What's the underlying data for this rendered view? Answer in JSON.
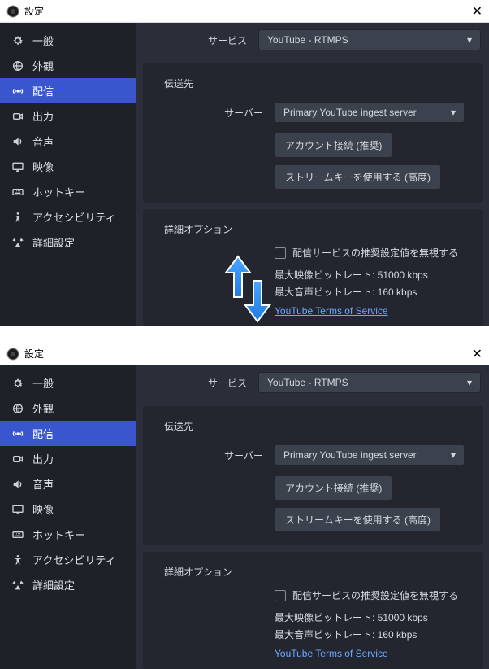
{
  "titlebar": {
    "title": "設定"
  },
  "sidebar": {
    "general": "一般",
    "appearance": "外観",
    "stream": "配信",
    "output": "出力",
    "audio": "音声",
    "video": "映像",
    "hotkeys": "ホットキー",
    "accessibility": "アクセシビリティ",
    "advanced": "詳細設定"
  },
  "main": {
    "service_label": "サービス",
    "service_value": "YouTube - RTMPS",
    "destination_head": "伝送先",
    "server_label": "サーバー",
    "server_value": "Primary YouTube ingest server",
    "connect_account_btn": "アカウント接続 (推奨)",
    "streamkey_btn": "ストリームキーを使用する (高度)",
    "advanced_head": "詳細オプション",
    "ignore_checkbox": "配信サービスの推奨設定値を無視する",
    "max_video": "最大映像ビットレート: 51000 kbps",
    "max_audio": "最大音声ビットレート: 160 kbps",
    "tos_link": "YouTube Terms of Service"
  }
}
